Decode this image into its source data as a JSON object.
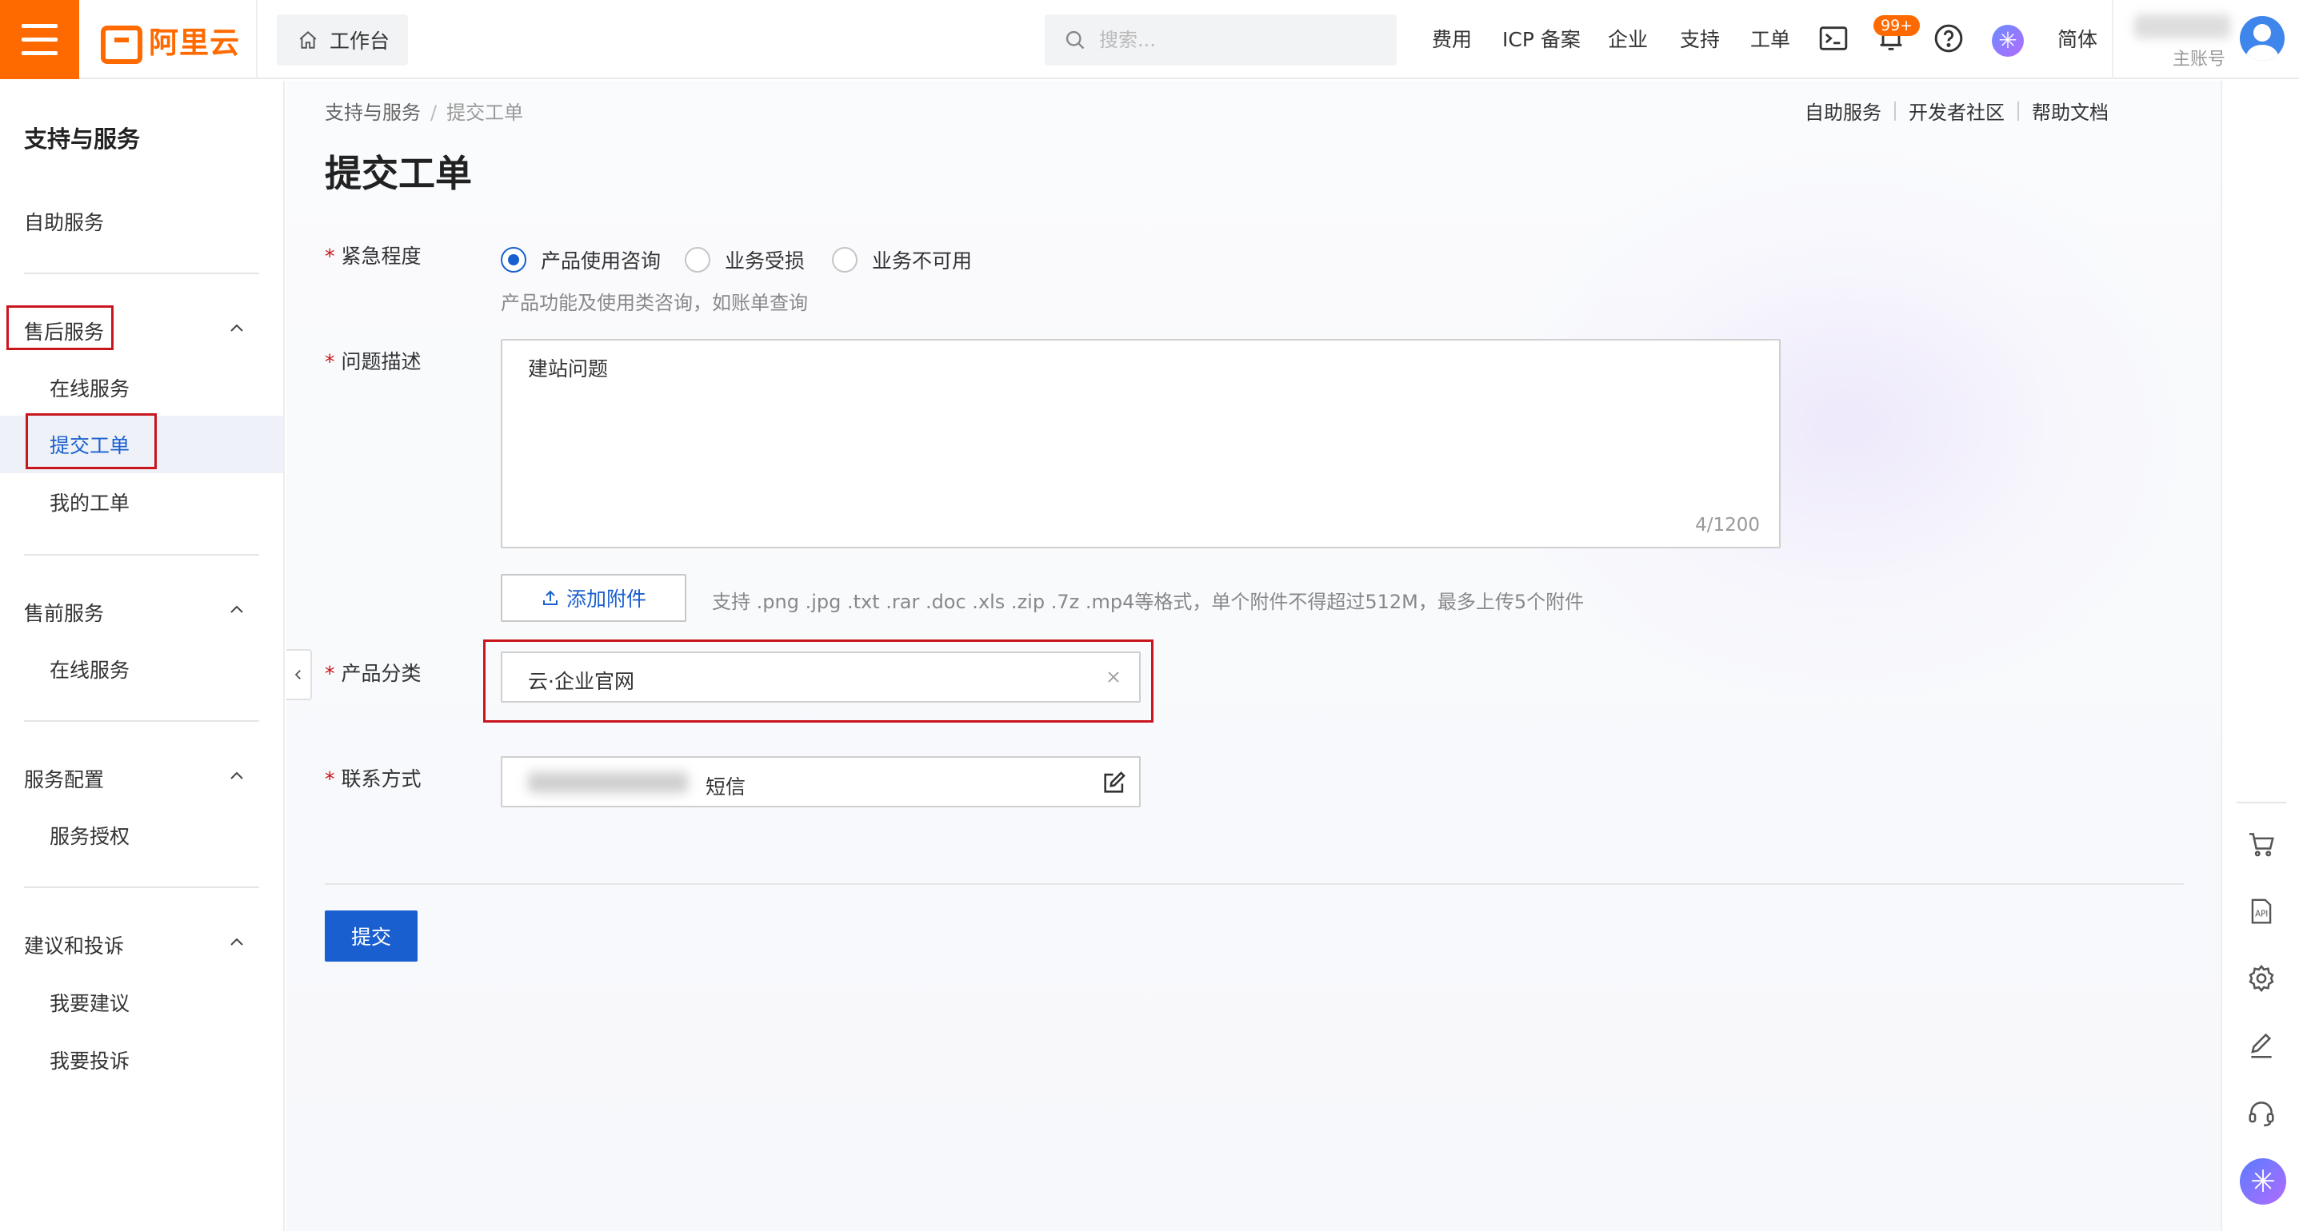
{
  "topbar": {
    "logo_text": "阿里云",
    "workbench_label": "工作台",
    "search_placeholder": "搜索...",
    "nav": [
      "费用",
      "ICP 备案",
      "企业",
      "支持",
      "工单"
    ],
    "notification_badge": "99+",
    "language": "简体",
    "account_type": "主账号"
  },
  "sidebar": {
    "title": "支持与服务",
    "self_service": "自助服务",
    "groups": [
      {
        "label": "售后服务",
        "items": [
          "在线服务",
          "提交工单",
          "我的工单"
        ]
      },
      {
        "label": "售前服务",
        "items": [
          "在线服务"
        ]
      },
      {
        "label": "服务配置",
        "items": [
          "服务授权"
        ]
      },
      {
        "label": "建议和投诉",
        "items": [
          "我要建议",
          "我要投诉"
        ]
      }
    ],
    "active_item": "提交工单"
  },
  "main": {
    "breadcrumb": {
      "parent": "支持与服务",
      "separator": "/",
      "current": "提交工单"
    },
    "top_links": [
      "自助服务",
      "开发者社区",
      "帮助文档"
    ],
    "page_title": "提交工单",
    "urgency": {
      "label": "紧急程度",
      "options": [
        "产品使用咨询",
        "业务受损",
        "业务不可用"
      ],
      "selected": "产品使用咨询",
      "hint": "产品功能及使用类咨询，如账单查询"
    },
    "description": {
      "label": "问题描述",
      "value": "建站问题",
      "counter": "4/1200"
    },
    "attachment": {
      "button_label": "添加附件",
      "hint": "支持 .png .jpg .txt .rar .doc .xls .zip .7z .mp4等格式，单个附件不得超过512M，最多上传5个附件"
    },
    "product": {
      "label": "产品分类",
      "value": "云·企业官网"
    },
    "contact": {
      "label": "联系方式",
      "method": "短信"
    },
    "submit_label": "提交"
  },
  "colors": {
    "brand": "#ff6a00",
    "primary": "#1a5fcf",
    "highlight_box": "#c8161d"
  }
}
